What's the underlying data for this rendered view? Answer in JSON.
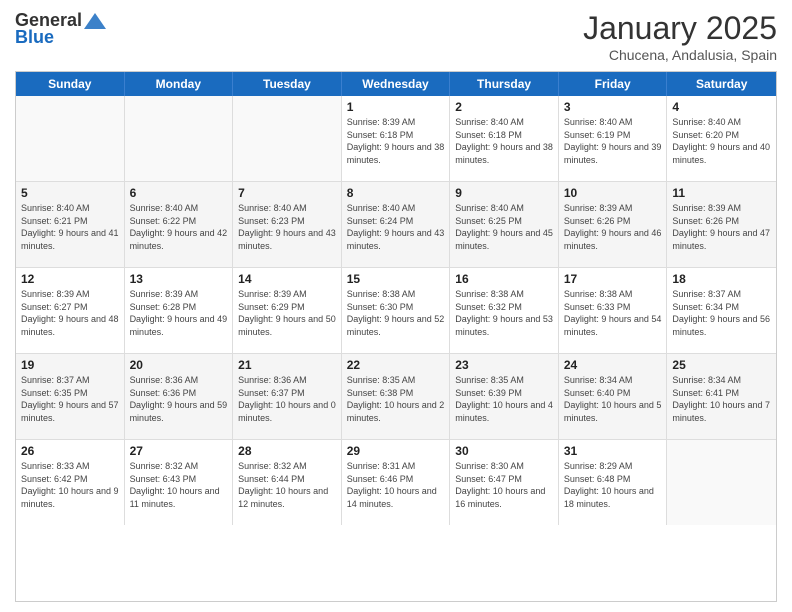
{
  "header": {
    "logo_general": "General",
    "logo_blue": "Blue",
    "title": "January 2025",
    "location": "Chucena, Andalusia, Spain"
  },
  "calendar": {
    "days": [
      "Sunday",
      "Monday",
      "Tuesday",
      "Wednesday",
      "Thursday",
      "Friday",
      "Saturday"
    ],
    "rows": [
      [
        {
          "day": "",
          "info": ""
        },
        {
          "day": "",
          "info": ""
        },
        {
          "day": "",
          "info": ""
        },
        {
          "day": "1",
          "info": "Sunrise: 8:39 AM\nSunset: 6:18 PM\nDaylight: 9 hours and 38 minutes."
        },
        {
          "day": "2",
          "info": "Sunrise: 8:40 AM\nSunset: 6:18 PM\nDaylight: 9 hours and 38 minutes."
        },
        {
          "day": "3",
          "info": "Sunrise: 8:40 AM\nSunset: 6:19 PM\nDaylight: 9 hours and 39 minutes."
        },
        {
          "day": "4",
          "info": "Sunrise: 8:40 AM\nSunset: 6:20 PM\nDaylight: 9 hours and 40 minutes."
        }
      ],
      [
        {
          "day": "5",
          "info": "Sunrise: 8:40 AM\nSunset: 6:21 PM\nDaylight: 9 hours and 41 minutes."
        },
        {
          "day": "6",
          "info": "Sunrise: 8:40 AM\nSunset: 6:22 PM\nDaylight: 9 hours and 42 minutes."
        },
        {
          "day": "7",
          "info": "Sunrise: 8:40 AM\nSunset: 6:23 PM\nDaylight: 9 hours and 43 minutes."
        },
        {
          "day": "8",
          "info": "Sunrise: 8:40 AM\nSunset: 6:24 PM\nDaylight: 9 hours and 43 minutes."
        },
        {
          "day": "9",
          "info": "Sunrise: 8:40 AM\nSunset: 6:25 PM\nDaylight: 9 hours and 45 minutes."
        },
        {
          "day": "10",
          "info": "Sunrise: 8:39 AM\nSunset: 6:26 PM\nDaylight: 9 hours and 46 minutes."
        },
        {
          "day": "11",
          "info": "Sunrise: 8:39 AM\nSunset: 6:26 PM\nDaylight: 9 hours and 47 minutes."
        }
      ],
      [
        {
          "day": "12",
          "info": "Sunrise: 8:39 AM\nSunset: 6:27 PM\nDaylight: 9 hours and 48 minutes."
        },
        {
          "day": "13",
          "info": "Sunrise: 8:39 AM\nSunset: 6:28 PM\nDaylight: 9 hours and 49 minutes."
        },
        {
          "day": "14",
          "info": "Sunrise: 8:39 AM\nSunset: 6:29 PM\nDaylight: 9 hours and 50 minutes."
        },
        {
          "day": "15",
          "info": "Sunrise: 8:38 AM\nSunset: 6:30 PM\nDaylight: 9 hours and 52 minutes."
        },
        {
          "day": "16",
          "info": "Sunrise: 8:38 AM\nSunset: 6:32 PM\nDaylight: 9 hours and 53 minutes."
        },
        {
          "day": "17",
          "info": "Sunrise: 8:38 AM\nSunset: 6:33 PM\nDaylight: 9 hours and 54 minutes."
        },
        {
          "day": "18",
          "info": "Sunrise: 8:37 AM\nSunset: 6:34 PM\nDaylight: 9 hours and 56 minutes."
        }
      ],
      [
        {
          "day": "19",
          "info": "Sunrise: 8:37 AM\nSunset: 6:35 PM\nDaylight: 9 hours and 57 minutes."
        },
        {
          "day": "20",
          "info": "Sunrise: 8:36 AM\nSunset: 6:36 PM\nDaylight: 9 hours and 59 minutes."
        },
        {
          "day": "21",
          "info": "Sunrise: 8:36 AM\nSunset: 6:37 PM\nDaylight: 10 hours and 0 minutes."
        },
        {
          "day": "22",
          "info": "Sunrise: 8:35 AM\nSunset: 6:38 PM\nDaylight: 10 hours and 2 minutes."
        },
        {
          "day": "23",
          "info": "Sunrise: 8:35 AM\nSunset: 6:39 PM\nDaylight: 10 hours and 4 minutes."
        },
        {
          "day": "24",
          "info": "Sunrise: 8:34 AM\nSunset: 6:40 PM\nDaylight: 10 hours and 5 minutes."
        },
        {
          "day": "25",
          "info": "Sunrise: 8:34 AM\nSunset: 6:41 PM\nDaylight: 10 hours and 7 minutes."
        }
      ],
      [
        {
          "day": "26",
          "info": "Sunrise: 8:33 AM\nSunset: 6:42 PM\nDaylight: 10 hours and 9 minutes."
        },
        {
          "day": "27",
          "info": "Sunrise: 8:32 AM\nSunset: 6:43 PM\nDaylight: 10 hours and 11 minutes."
        },
        {
          "day": "28",
          "info": "Sunrise: 8:32 AM\nSunset: 6:44 PM\nDaylight: 10 hours and 12 minutes."
        },
        {
          "day": "29",
          "info": "Sunrise: 8:31 AM\nSunset: 6:46 PM\nDaylight: 10 hours and 14 minutes."
        },
        {
          "day": "30",
          "info": "Sunrise: 8:30 AM\nSunset: 6:47 PM\nDaylight: 10 hours and 16 minutes."
        },
        {
          "day": "31",
          "info": "Sunrise: 8:29 AM\nSunset: 6:48 PM\nDaylight: 10 hours and 18 minutes."
        },
        {
          "day": "",
          "info": ""
        }
      ]
    ]
  }
}
